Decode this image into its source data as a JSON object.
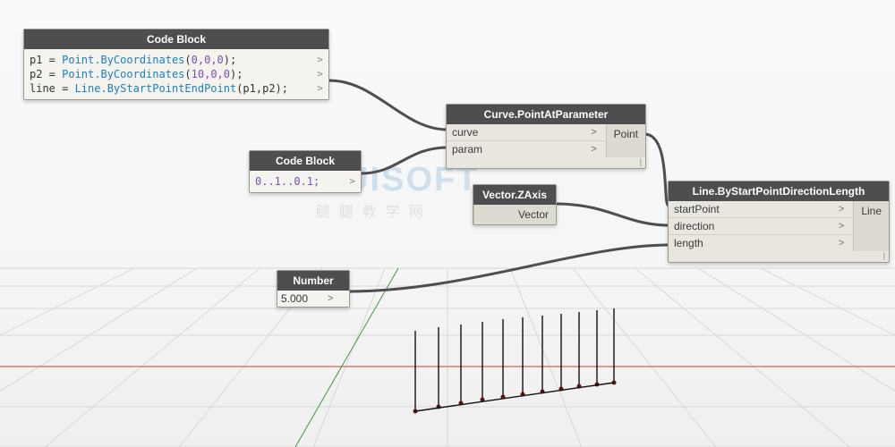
{
  "nodes": {
    "codeblock1": {
      "title": "Code Block",
      "lines": [
        {
          "pre": "p1 = ",
          "fn": "Point.ByCoordinates",
          "args": "(",
          "nums": "0,0,0",
          "end": ");"
        },
        {
          "pre": "p2 = ",
          "fn": "Point.ByCoordinates",
          "args": "(",
          "nums": "10,0,0",
          "end": ");"
        },
        {
          "pre": "line = ",
          "fn": "Line.ByStartPointEndPoint",
          "args": "(p1,p2);",
          "nums": "",
          "end": ""
        }
      ]
    },
    "codeblock2": {
      "title": "Code Block",
      "code": "0..1..0.1;"
    },
    "number": {
      "title": "Number",
      "value": "5.000"
    },
    "pointAtParam": {
      "title": "Curve.PointAtParameter",
      "inputs": [
        "curve",
        "param"
      ],
      "output": "Point"
    },
    "zaxis": {
      "title": "Vector.ZAxis",
      "output": "Vector"
    },
    "lineByDir": {
      "title": "Line.ByStartPointDirectionLength",
      "inputs": [
        "startPoint",
        "direction",
        "length"
      ],
      "output": "Line"
    }
  },
  "watermark": {
    "main": "TUBUISOFT",
    "sub": "腿腿教学网"
  }
}
